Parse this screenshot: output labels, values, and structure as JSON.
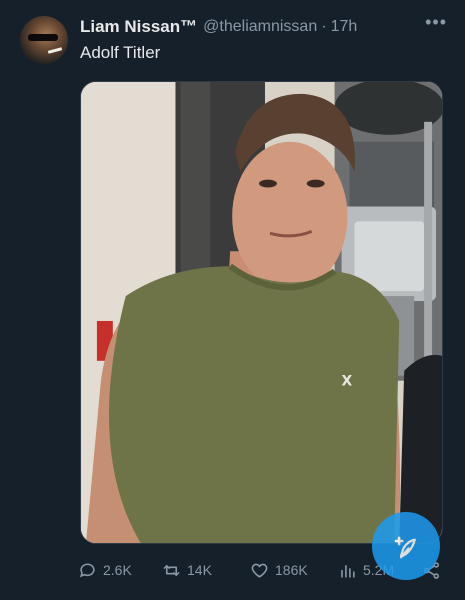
{
  "tweet": {
    "display_name": "Liam Nissan™",
    "handle": "@theliamnissan",
    "separator": "·",
    "time": "17h",
    "text": "Adolf Titler",
    "more_icon": "more-dots-icon"
  },
  "actions": {
    "replies": "2.6K",
    "retweets": "14K",
    "likes": "186K",
    "views": "5.2M"
  },
  "colors": {
    "background": "#15202b",
    "accent": "#1d9bf0",
    "muted": "#8b98a5",
    "text": "#e7e9ea"
  }
}
